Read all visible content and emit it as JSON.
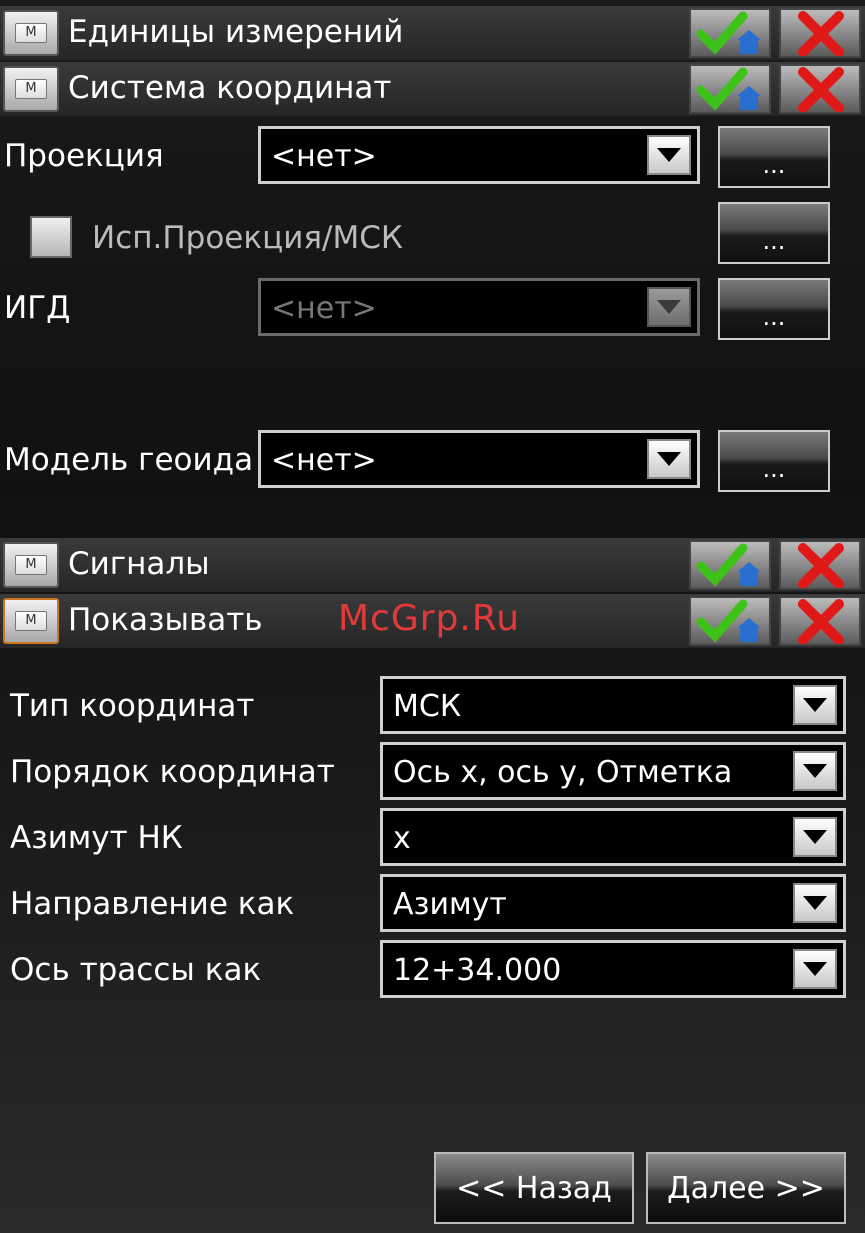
{
  "headers": [
    {
      "id": "units",
      "label": "Единицы измерений",
      "orange": false
    },
    {
      "id": "coord-system",
      "label": "Система координат",
      "orange": false
    },
    {
      "id": "signals",
      "label": "Сигналы",
      "orange": false
    },
    {
      "id": "show",
      "label": "Показывать",
      "orange": true
    }
  ],
  "m_button_glyph": "M",
  "coord": {
    "projection": {
      "label": "Проекция",
      "value": "<нет>"
    },
    "use_projection": {
      "label": "Исп.Проекция/МСК",
      "checked": false
    },
    "igd": {
      "label": "ИГД",
      "value": "<нет>",
      "disabled": true
    },
    "geoid": {
      "label": "Модель геоида",
      "value": "<нет>"
    },
    "dots_label": "..."
  },
  "show": {
    "coord_type": {
      "label": "Тип координат",
      "value": "МСК"
    },
    "coord_order": {
      "label": "Порядок координат",
      "value": "Ось x, ось y, Отметка"
    },
    "azimuth": {
      "label": "Азимут НК",
      "value": "x"
    },
    "direction": {
      "label": "Направление как",
      "value": "Азимут"
    },
    "route_axis": {
      "label": "Ось трассы как",
      "value": "12+34.000"
    }
  },
  "nav": {
    "back": "<< Назад",
    "next": "Далее >>"
  },
  "watermark": "McGrp.Ru",
  "colors": {
    "ok_green": "#3ec21a",
    "x_red": "#e01818",
    "house_blue": "#2a6fd0",
    "accent_orange": "#c8781e"
  }
}
